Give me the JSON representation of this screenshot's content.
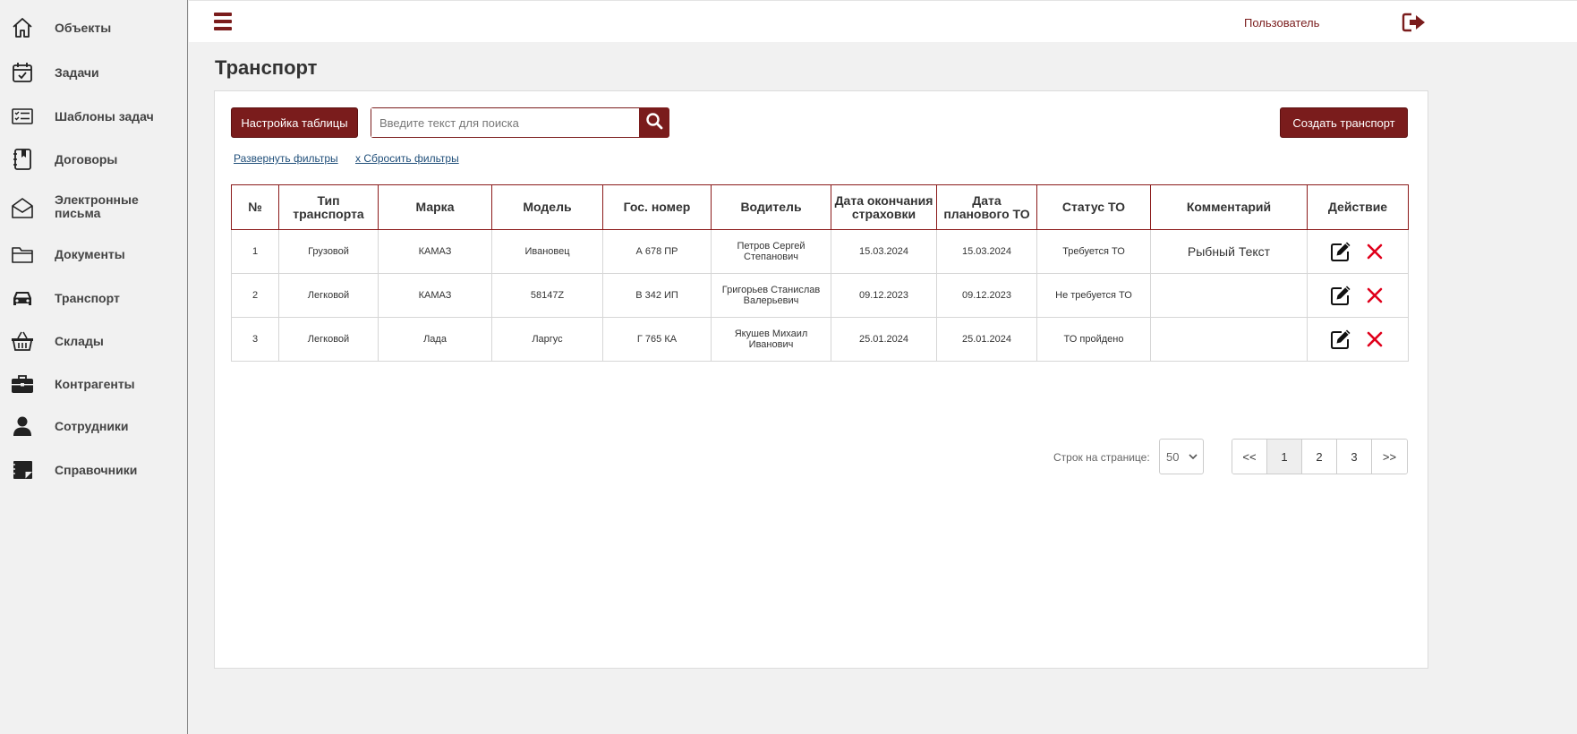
{
  "sidebar": {
    "items": [
      {
        "label": "Объекты",
        "icon": "home-icon"
      },
      {
        "label": "Задачи",
        "icon": "calendar-check-icon"
      },
      {
        "label": "Шаблоны задач",
        "icon": "checklist-icon"
      },
      {
        "label": "Договоры",
        "icon": "contract-book-icon"
      },
      {
        "label": "Электронные письма",
        "icon": "envelope-icon"
      },
      {
        "label": "Документы",
        "icon": "folder-icon"
      },
      {
        "label": "Транспорт",
        "icon": "car-icon"
      },
      {
        "label": "Склады",
        "icon": "basket-icon"
      },
      {
        "label": "Контрагенты",
        "icon": "briefcase-icon"
      },
      {
        "label": "Сотрудники",
        "icon": "user-icon"
      },
      {
        "label": "Справочники",
        "icon": "notebook-icon"
      }
    ]
  },
  "header": {
    "user_label": "Пользователь"
  },
  "page": {
    "title": "Транспорт"
  },
  "toolbar": {
    "settings_label": "Настройка таблицы",
    "search_placeholder": "Введите текст для поиска",
    "create_label": "Создать транспорт",
    "expand_filters": "Развернуть фильтры",
    "reset_filters": "x Сбросить фильтры"
  },
  "table": {
    "columns": [
      "№",
      "Тип транспорта",
      "Марка",
      "Модель",
      "Гос. номер",
      "Водитель",
      "Дата окончания страховки",
      "Дата планового ТО",
      "Статус ТО",
      "Комментарий",
      "Действие"
    ],
    "rows": [
      {
        "num": "1",
        "type": "Грузовой",
        "brand": "КАМАЗ",
        "model": "Ивановец",
        "plate": "А 678 ПР",
        "driver": "Петров Сергей Степанович",
        "insurance": "15.03.2024",
        "planned_to": "15.03.2024",
        "status": "Требуется ТО",
        "comment": "Рыбный Текст"
      },
      {
        "num": "2",
        "type": "Легковой",
        "brand": "КАМАЗ",
        "model": "58147Z",
        "plate": "В 342 ИП",
        "driver": "Григорьев Станислав Валерьевич",
        "insurance": "09.12.2023",
        "planned_to": "09.12.2023",
        "status": "Не требуется ТО",
        "comment": ""
      },
      {
        "num": "3",
        "type": "Легковой",
        "brand": "Лада",
        "model": "Ларгус",
        "plate": "Г 765 КА",
        "driver": "Якушев Михаил Иванович",
        "insurance": "25.01.2024",
        "planned_to": "25.01.2024",
        "status": "ТО пройдено",
        "comment": ""
      }
    ]
  },
  "pagination": {
    "rows_label": "Строк на странице:",
    "rows_value": "50",
    "first": "<<",
    "pages": [
      "1",
      "2",
      "3"
    ],
    "active_page": "1",
    "last": ">>"
  },
  "colors": {
    "accent": "#7a1c1c",
    "delete": "#e0001b"
  }
}
